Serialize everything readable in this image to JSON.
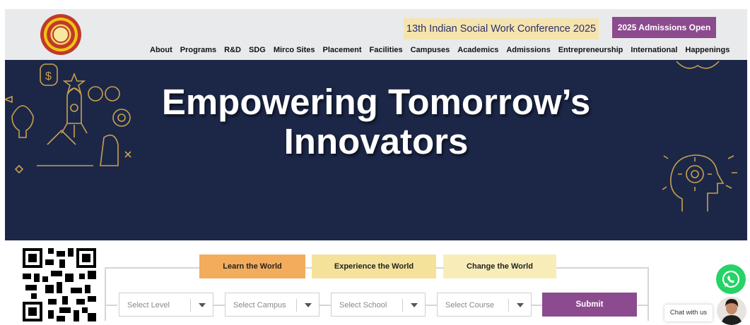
{
  "header": {
    "conference_banner": "13th Indian Social Work Conference 2025",
    "admissions_button": "2025 Admissions Open",
    "nav": [
      "About",
      "Programs",
      "R&D",
      "SDG",
      "Mirco Sites",
      "Placement",
      "Facilities",
      "Campuses",
      "Academics",
      "Admissions",
      "Entrepreneurship",
      "International",
      "Happenings"
    ]
  },
  "hero": {
    "title_line1": "Empowering Tomorrow’s",
    "title_line2": "Innovators",
    "background_color": "#1c2748",
    "art_color": "#c9a14a"
  },
  "finder": {
    "tabs": [
      "Learn the World",
      "Experience the World",
      "Change the World"
    ],
    "selects": [
      "Select Level",
      "Select Campus",
      "Select School",
      "Select Course"
    ],
    "submit_label": "Submit"
  },
  "chat": {
    "label": "Chat with us"
  },
  "colors": {
    "accent_purple": "#8c4a8f",
    "tab_orange": "#f3ab5c",
    "whatsapp_green": "#25d366"
  }
}
